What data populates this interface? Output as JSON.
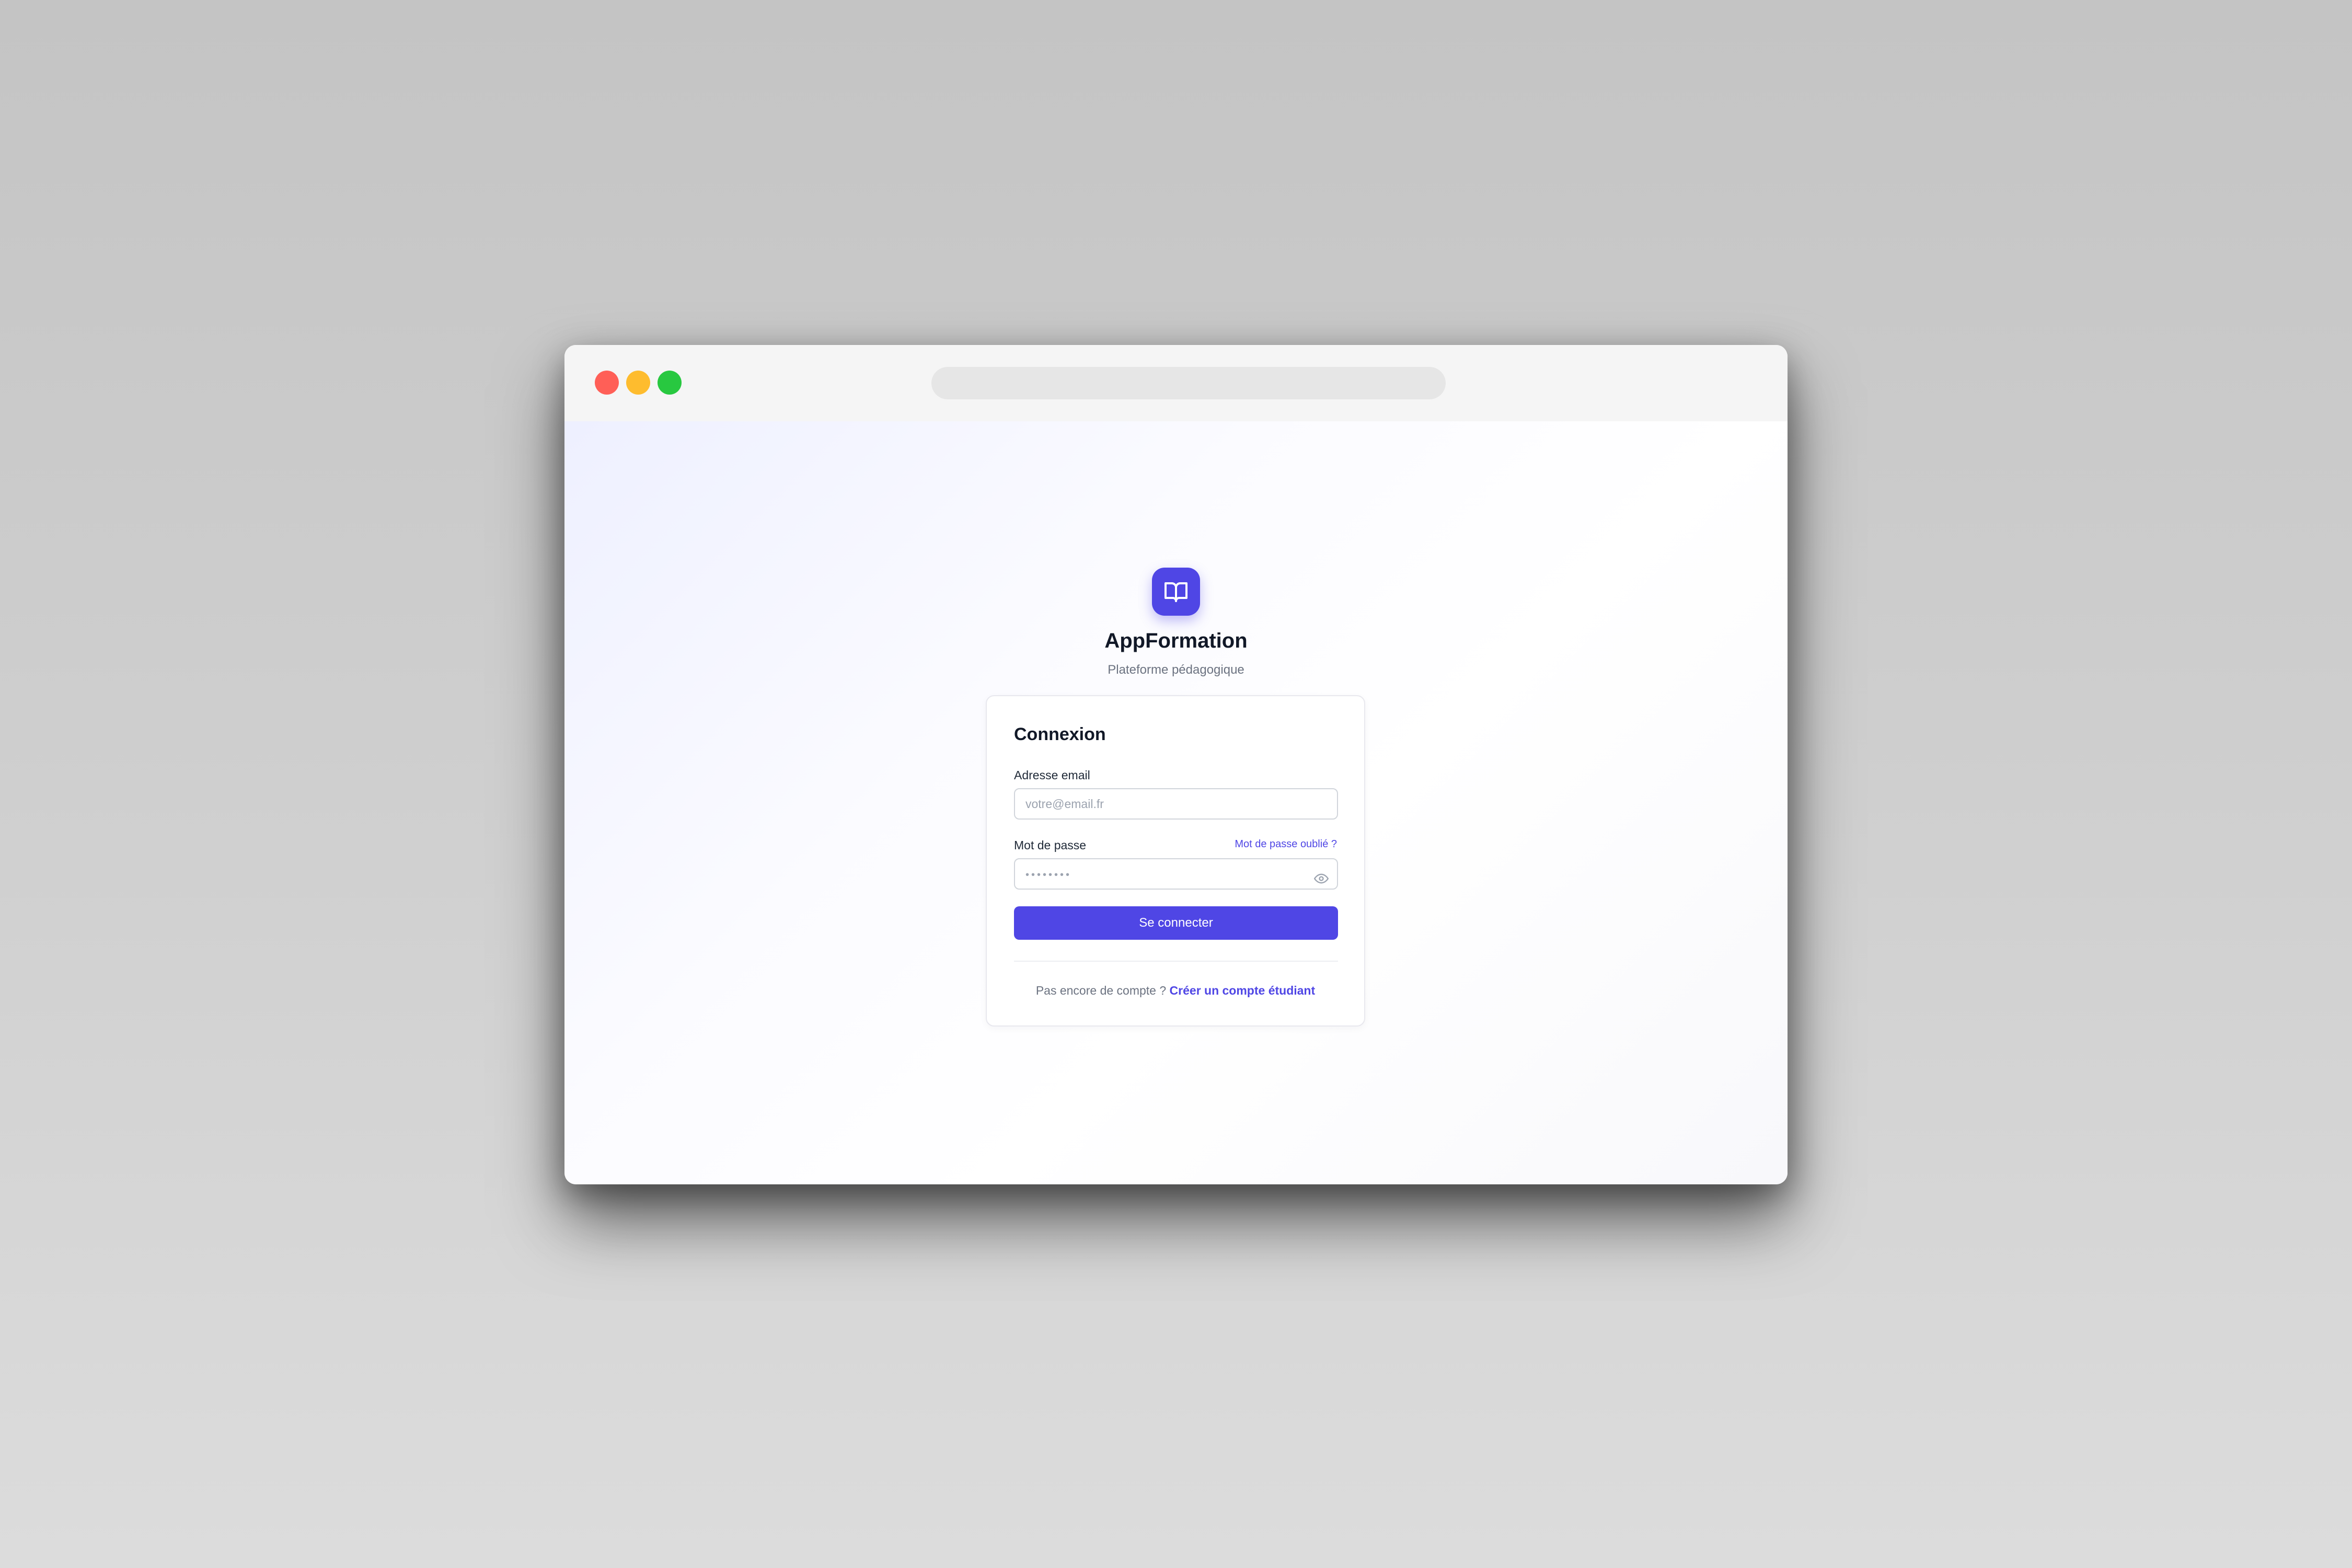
{
  "window": {
    "traffic_lights": [
      "close",
      "minimize",
      "maximize"
    ],
    "url": ""
  },
  "brand": {
    "logo_icon": "book-open-icon",
    "name": "AppFormation",
    "tagline": "Plateforme pédagogique",
    "accent_color": "#4f46e5"
  },
  "login": {
    "title": "Connexion",
    "email": {
      "label": "Adresse email",
      "placeholder": "votre@email.fr",
      "value": ""
    },
    "password": {
      "label": "Mot de passe",
      "masked_value": "••••••••",
      "forgot_label": "Mot de passe oublié ?",
      "toggle_icon": "eye-icon"
    },
    "submit_label": "Se connecter",
    "signup_prompt": "Pas encore de compte ?",
    "signup_link": "Créer un compte étudiant"
  }
}
